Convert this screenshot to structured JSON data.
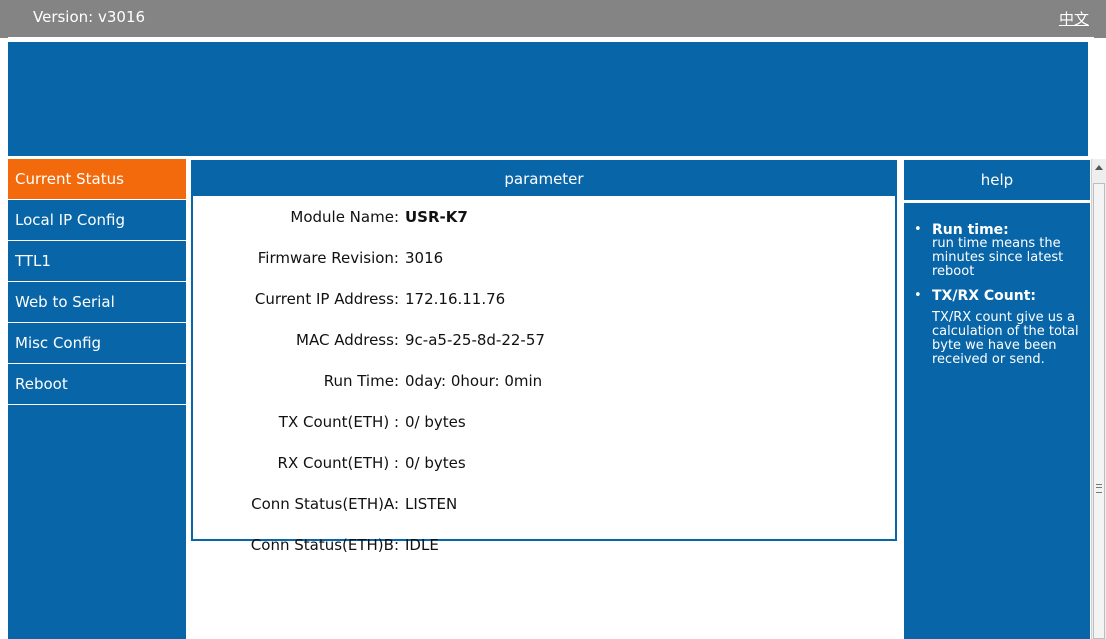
{
  "header": {
    "version_text": "Version: v3016",
    "language_link": "中文"
  },
  "sidebar": {
    "items": [
      {
        "label": "Current Status"
      },
      {
        "label": "Local IP Config"
      },
      {
        "label": "TTL1"
      },
      {
        "label": "Web to Serial"
      },
      {
        "label": "Misc Config"
      },
      {
        "label": "Reboot"
      }
    ]
  },
  "parameter": {
    "header": "parameter",
    "rows": [
      {
        "label": "Module Name:",
        "value": "USR-K7"
      },
      {
        "label": "Firmware Revision:",
        "value": "3016"
      },
      {
        "label": "Current IP Address:",
        "value": "172.16.11.76"
      },
      {
        "label": "MAC Address:",
        "value": "9c-a5-25-8d-22-57"
      },
      {
        "label": "Run Time:",
        "value": "0day: 0hour: 0min"
      },
      {
        "label": "TX Count(ETH) :",
        "value": "0/ bytes"
      },
      {
        "label": "RX Count(ETH) :",
        "value": "0/ bytes"
      },
      {
        "label": "Conn Status(ETH)A:",
        "value": "LISTEN"
      },
      {
        "label": "Conn Status(ETH)B:",
        "value": "IDLE"
      }
    ]
  },
  "help": {
    "header": "help",
    "items": [
      {
        "title": "Run time:",
        "desc": "run time means the minutes since latest reboot"
      },
      {
        "title": "TX/RX Count:",
        "desc": "TX/RX count give us a calculation of the total byte we have been received or send."
      }
    ]
  },
  "colors": {
    "brand_blue": "#0865a8",
    "active_orange": "#f26a0c",
    "topbar_gray": "#848484"
  }
}
